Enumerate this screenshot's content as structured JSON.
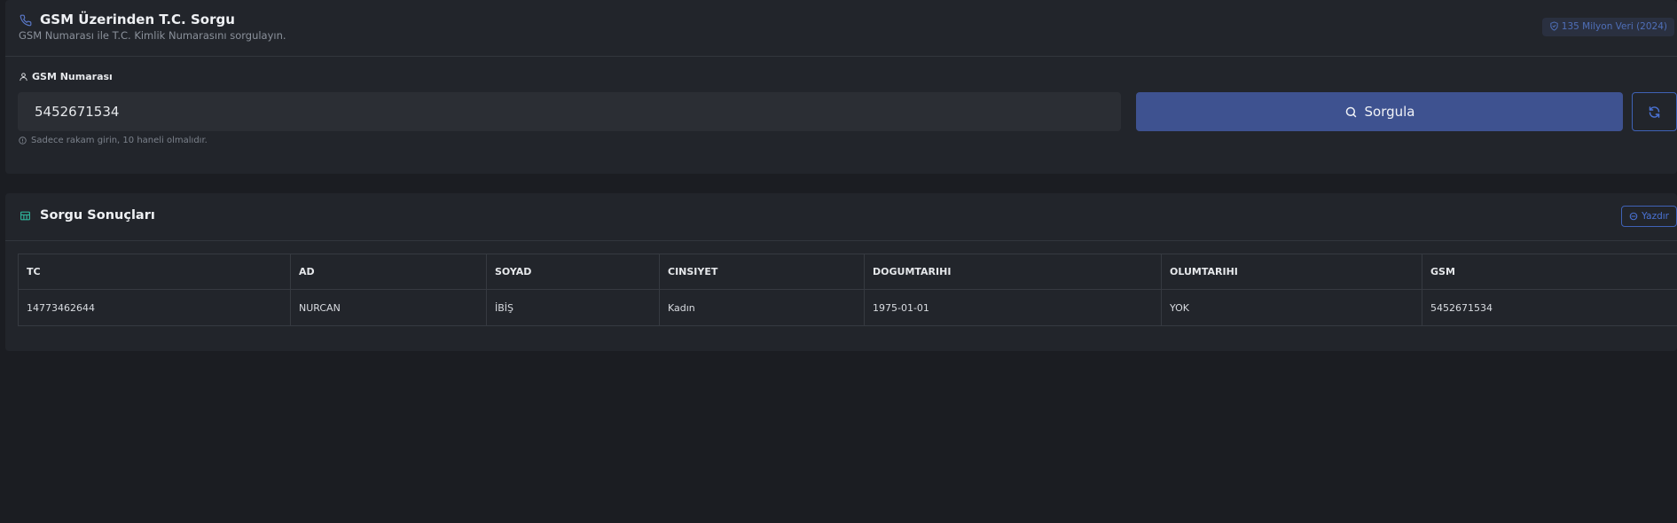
{
  "header": {
    "title": "GSM Üzerinden T.C. Sorgu",
    "subtitle": "GSM Numarası ile T.C. Kimlik Numarasını sorgulayın.",
    "badge": "135 Milyon Veri (2024)"
  },
  "form": {
    "label": "GSM Numarası",
    "value": "5452671534",
    "hint": "Sadece rakam girin, 10 haneli olmalıdır.",
    "search_label": "Sorgula"
  },
  "results": {
    "title": "Sorgu Sonuçları",
    "print_label": "Yazdır",
    "columns": [
      "TC",
      "AD",
      "SOYAD",
      "CINSIYET",
      "DOGUMTARIHI",
      "OLUMTARIHI",
      "GSM"
    ],
    "rows": [
      [
        "14773462644",
        "NURCAN",
        "İBİŞ",
        "Kadın",
        "1975-01-01",
        "YOK",
        "5452671534"
      ]
    ]
  },
  "colors": {
    "background": "#1b1d22",
    "card": "#22252b",
    "primary": "#3e5290",
    "accent_blue": "#4a72d4",
    "table_icon": "#2fb39a"
  },
  "icons": {
    "title": "phone-icon",
    "badge": "shield-check-icon",
    "label": "user-icon",
    "hint": "info-circle-icon",
    "search": "search-icon",
    "refresh": "refresh-icon",
    "results": "table-icon",
    "print": "print-icon"
  }
}
